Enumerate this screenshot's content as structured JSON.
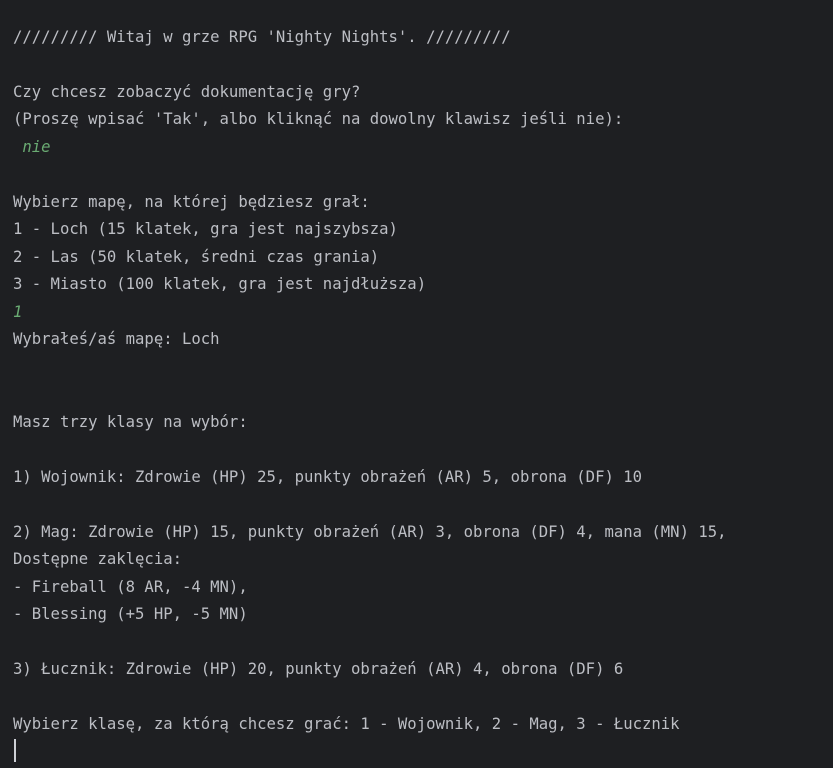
{
  "console": {
    "lines": {
      "welcome": "///////// Witaj w grze RPG 'Nighty Nights'. /////////",
      "docs_question": "Czy chcesz zobaczyć dokumentację gry?",
      "docs_prompt": "(Proszę wpisać 'Tak', albo kliknąć na dowolny klawisz jeśli nie):",
      "docs_answer": " nie",
      "map_prompt": "Wybierz mapę, na której będziesz grał:",
      "map_option_1": "1 - Loch (15 klatek, gra jest najszybsza)",
      "map_option_2": "2 - Las (50 klatek, średni czas grania)",
      "map_option_3": "3 - Miasto (100 klatek, gra jest najdłuższa)",
      "map_answer": "1",
      "map_chosen": "Wybrałeś/aś mapę: Loch",
      "class_intro": "Masz trzy klasy na wybór:",
      "class_warrior": "1) Wojownik: Zdrowie (HP) 25, punkty obrażeń (AR) 5, obrona (DF) 10",
      "class_mage": "2) Mag: Zdrowie (HP) 15, punkty obrażeń (AR) 3, obrona (DF) 4, mana (MN) 15,",
      "spells_header": "Dostępne zaklęcia:",
      "spell_fireball": "- Fireball (8 AR, -4 MN),",
      "spell_blessing": "- Blessing (+5 HP, -5 MN)",
      "class_archer": "3) Łucznik: Zdrowie (HP) 20, punkty obrażeń (AR) 4, obrona (DF) 6",
      "class_prompt": "Wybierz klasę, za którą chcesz grać: 1 - Wojownik, 2 - Mag, 3 - Łucznik"
    }
  },
  "colors": {
    "background": "#1e1f22",
    "text": "#bcbec4",
    "user_input": "#6aab73"
  }
}
